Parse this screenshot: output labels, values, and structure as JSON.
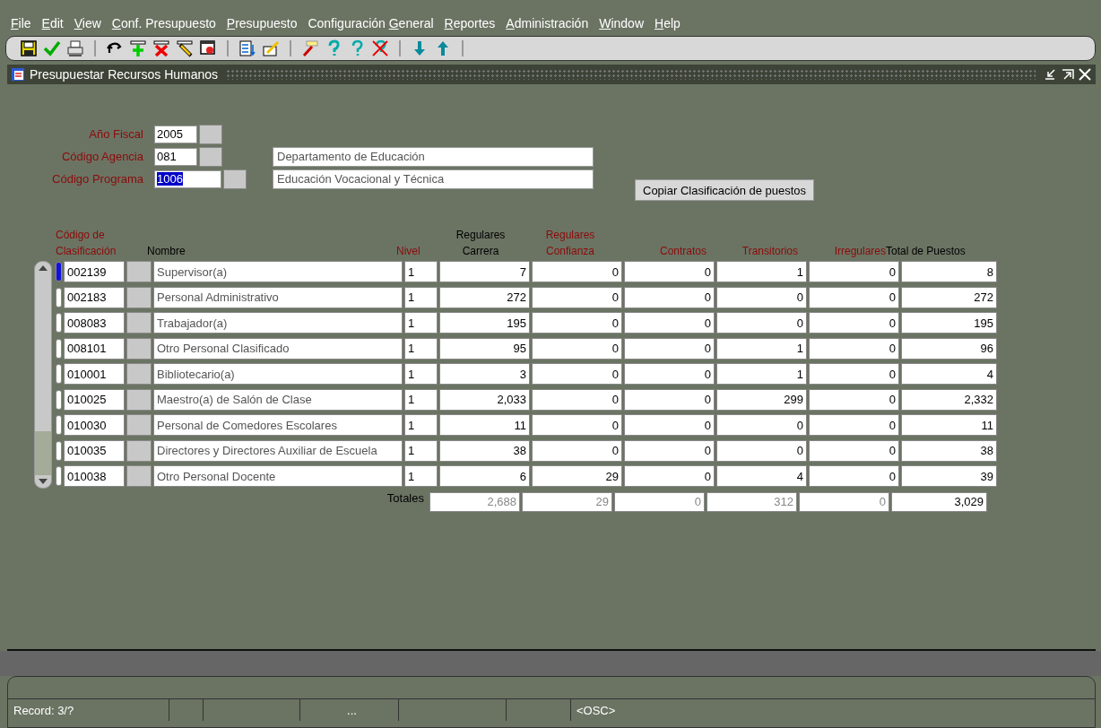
{
  "menu": [
    {
      "label": "File"
    },
    {
      "label": "Edit"
    },
    {
      "label": "View"
    },
    {
      "label": "Conf. Presupuesto"
    },
    {
      "label": "Presupuesto"
    },
    {
      "label": "Configuración General"
    },
    {
      "label": "Reportes"
    },
    {
      "label": "Administración"
    },
    {
      "label": "Window"
    },
    {
      "label": "Help"
    }
  ],
  "window": {
    "title": "Presupuestar Recursos Humanos"
  },
  "header": {
    "fields": [
      {
        "label": "Año Fiscal",
        "value": "2005",
        "selected": false
      },
      {
        "label": "Código Agencia",
        "value": "081",
        "selected": false,
        "description": "Departamento de Educación"
      },
      {
        "label": "Código Programa",
        "value": "1006",
        "selected": true,
        "description": "Educación Vocacional y Técnica"
      }
    ],
    "copy_button": "Copiar Clasificación de puestos"
  },
  "table": {
    "columns": [
      {
        "label": "Código de Clasificación",
        "required": true
      },
      {
        "label": "Nombre",
        "required": false
      },
      {
        "label": "Nivel",
        "required": true
      },
      {
        "label": "Regulares Carrera",
        "required": false
      },
      {
        "label": "Regulares Confianza",
        "required": true
      },
      {
        "label": "Contratos",
        "required": true
      },
      {
        "label": "Transitorios",
        "required": true
      },
      {
        "label": "Irregulares",
        "required": true
      },
      {
        "label": "Total de Puestos",
        "required": false
      }
    ],
    "rows": [
      {
        "code": "002139",
        "name": "Supervisor(a)",
        "nivel": "1",
        "values": [
          "7",
          "0",
          "0",
          "1",
          "0",
          "8"
        ],
        "selected": true
      },
      {
        "code": "002183",
        "name": "Personal  Administrativo",
        "nivel": "1",
        "values": [
          "272",
          "0",
          "0",
          "0",
          "0",
          "272"
        ],
        "selected": false
      },
      {
        "code": "008083",
        "name": "Trabajador(a)",
        "nivel": "1",
        "values": [
          "195",
          "0",
          "0",
          "0",
          "0",
          "195"
        ],
        "selected": false
      },
      {
        "code": "008101",
        "name": "Otro Personal Clasificado",
        "nivel": "1",
        "values": [
          "95",
          "0",
          "0",
          "1",
          "0",
          "96"
        ],
        "selected": false
      },
      {
        "code": "010001",
        "name": "Bibliotecario(a)",
        "nivel": "1",
        "values": [
          "3",
          "0",
          "0",
          "1",
          "0",
          "4"
        ],
        "selected": false
      },
      {
        "code": "010025",
        "name": "Maestro(a) de Salón de Clase",
        "nivel": "1",
        "values": [
          "2,033",
          "0",
          "0",
          "299",
          "0",
          "2,332"
        ],
        "selected": false
      },
      {
        "code": "010030",
        "name": "Personal de Comedores Escolares",
        "nivel": "1",
        "values": [
          "11",
          "0",
          "0",
          "0",
          "0",
          "11"
        ],
        "selected": false
      },
      {
        "code": "010035",
        "name": "Directores y Directores Auxiliar de Escuela",
        "nivel": "1",
        "values": [
          "38",
          "0",
          "0",
          "0",
          "0",
          "38"
        ],
        "selected": false
      },
      {
        "code": "010038",
        "name": "Otro Personal Docente",
        "nivel": "1",
        "values": [
          "6",
          "29",
          "0",
          "4",
          "0",
          "39"
        ],
        "selected": false
      }
    ],
    "totals_label": "Totales",
    "totals": [
      {
        "value": "2,688",
        "disabled": true
      },
      {
        "value": "29",
        "disabled": true
      },
      {
        "value": "0",
        "disabled": true
      },
      {
        "value": "312",
        "disabled": true
      },
      {
        "value": "0",
        "disabled": true
      },
      {
        "value": "3,029",
        "disabled": false
      }
    ]
  },
  "status_bar": {
    "record": "Record: 3/?",
    "ellipsis": "...",
    "mode": "<OSC>"
  }
}
